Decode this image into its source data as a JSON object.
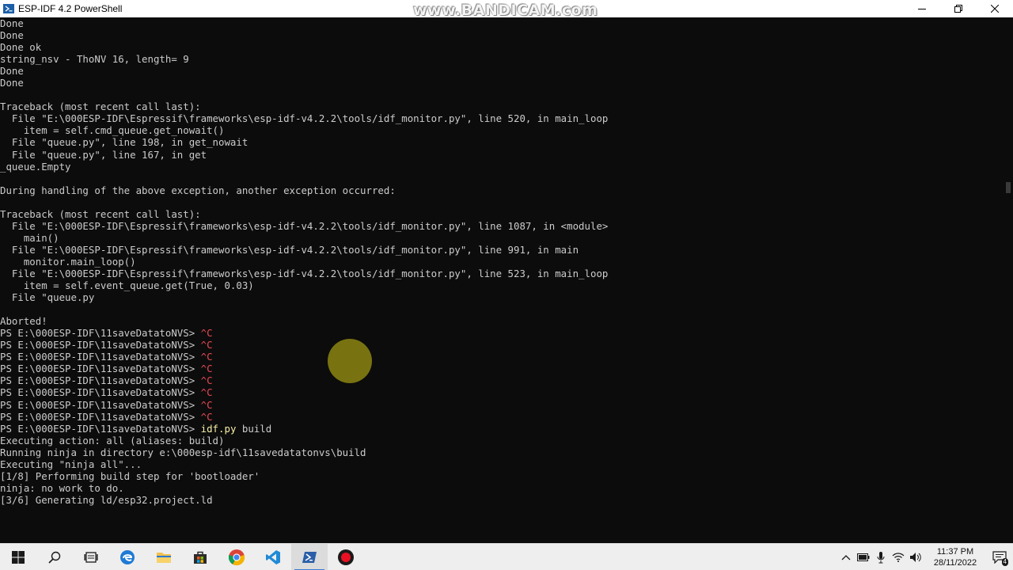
{
  "window": {
    "title": "ESP-IDF 4.2 PowerShell",
    "watermark": "www.BANDICAM.com",
    "minimize_icon": "minimize-icon",
    "maximize_icon": "restore-icon",
    "close_icon": "close-icon"
  },
  "terminal": {
    "lines": [
      {
        "text": "Done"
      },
      {
        "text": "Done"
      },
      {
        "text": "Done ok"
      },
      {
        "text": "string_nsv - ThoNV 16, length= 9"
      },
      {
        "text": "Done"
      },
      {
        "text": "Done"
      },
      {
        "text": ""
      },
      {
        "text": "Traceback (most recent call last):"
      },
      {
        "text": "  File \"E:\\000ESP-IDF\\Espressif\\frameworks\\esp-idf-v4.2.2\\tools/idf_monitor.py\", line 520, in main_loop"
      },
      {
        "text": "    item = self.cmd_queue.get_nowait()"
      },
      {
        "text": "  File \"queue.py\", line 198, in get_nowait"
      },
      {
        "text": "  File \"queue.py\", line 167, in get"
      },
      {
        "text": "_queue.Empty"
      },
      {
        "text": ""
      },
      {
        "text": "During handling of the above exception, another exception occurred:"
      },
      {
        "text": ""
      },
      {
        "text": "Traceback (most recent call last):"
      },
      {
        "text": "  File \"E:\\000ESP-IDF\\Espressif\\frameworks\\esp-idf-v4.2.2\\tools/idf_monitor.py\", line 1087, in <module>"
      },
      {
        "text": "    main()"
      },
      {
        "text": "  File \"E:\\000ESP-IDF\\Espressif\\frameworks\\esp-idf-v4.2.2\\tools/idf_monitor.py\", line 991, in main"
      },
      {
        "text": "    monitor.main_loop()"
      },
      {
        "text": "  File \"E:\\000ESP-IDF\\Espressif\\frameworks\\esp-idf-v4.2.2\\tools/idf_monitor.py\", line 523, in main_loop"
      },
      {
        "text": "    item = self.event_queue.get(True, 0.03)"
      },
      {
        "text": "  File \"queue.py"
      },
      {
        "text": ""
      },
      {
        "text": "Aborted!"
      },
      {
        "text": "PS E:\\000ESP-IDF\\11saveDatatoNVS> ",
        "ctrl": "^C"
      },
      {
        "text": "PS E:\\000ESP-IDF\\11saveDatatoNVS> ",
        "ctrl": "^C"
      },
      {
        "text": "PS E:\\000ESP-IDF\\11saveDatatoNVS> ",
        "ctrl": "^C"
      },
      {
        "text": "PS E:\\000ESP-IDF\\11saveDatatoNVS> ",
        "ctrl": "^C"
      },
      {
        "text": "PS E:\\000ESP-IDF\\11saveDatatoNVS> ",
        "ctrl": "^C"
      },
      {
        "text": "PS E:\\000ESP-IDF\\11saveDatatoNVS> ",
        "ctrl": "^C"
      },
      {
        "text": "PS E:\\000ESP-IDF\\11saveDatatoNVS> ",
        "ctrl": "^C"
      },
      {
        "text": "PS E:\\000ESP-IDF\\11saveDatatoNVS> ",
        "ctrl": "^C"
      },
      {
        "text": "PS E:\\000ESP-IDF\\11saveDatatoNVS> ",
        "cmd": "idf.py",
        "args": " build"
      },
      {
        "text": "Executing action: all (aliases: build)"
      },
      {
        "text": "Running ninja in directory e:\\000esp-idf\\11savedatatonvs\\build"
      },
      {
        "text": "Executing \"ninja all\"..."
      },
      {
        "text": "[1/8] Performing build step for 'bootloader'"
      },
      {
        "text": "ninja: no work to do."
      },
      {
        "text": "[3/6] Generating ld/esp32.project.ld"
      }
    ]
  },
  "taskbar": {
    "items": [
      {
        "name": "start-button",
        "icon": "windows-logo-icon",
        "active": false
      },
      {
        "name": "search-button",
        "icon": "search-icon",
        "active": false
      },
      {
        "name": "task-view-button",
        "icon": "task-view-icon",
        "active": false
      },
      {
        "name": "edge-button",
        "icon": "edge-icon",
        "active": false
      },
      {
        "name": "file-explorer-button",
        "icon": "folder-icon",
        "active": false
      },
      {
        "name": "store-button",
        "icon": "store-icon",
        "active": false
      },
      {
        "name": "chrome-button",
        "icon": "chrome-icon",
        "active": false
      },
      {
        "name": "vscode-button",
        "icon": "vscode-icon",
        "active": false
      },
      {
        "name": "powershell-button",
        "icon": "powershell-icon",
        "active": true
      },
      {
        "name": "bandicam-button",
        "icon": "record-icon",
        "active": false
      }
    ],
    "clock": {
      "time": "11:37 PM",
      "date": "28/11/2022"
    },
    "notification_badge": "4"
  },
  "colors": {
    "terminal_bg": "#0c0c0c",
    "terminal_fg": "#cccccc",
    "ctrl_c": "#e74856",
    "command": "#f9f1a5",
    "taskbar_bg": "#eeeeee"
  }
}
